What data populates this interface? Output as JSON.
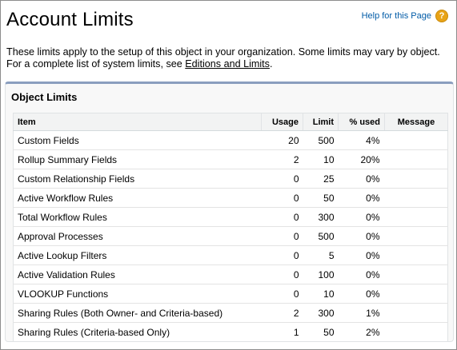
{
  "page": {
    "title": "Account Limits",
    "help_label": "Help for this Page",
    "intro_text": "These limits apply to the setup of this object in your organization. Some limits may vary by object. For a complete list of system limits, see ",
    "intro_link": "Editions and Limits",
    "intro_end": "."
  },
  "panel": {
    "title": "Object Limits"
  },
  "table": {
    "headers": {
      "item": "Item",
      "usage": "Usage",
      "limit": "Limit",
      "pct": "% used",
      "message": "Message"
    },
    "rows": [
      {
        "item": "Custom Fields",
        "usage": "20",
        "limit": "500",
        "pct": "4%",
        "message": ""
      },
      {
        "item": "Rollup Summary Fields",
        "usage": "2",
        "limit": "10",
        "pct": "20%",
        "message": ""
      },
      {
        "item": "Custom Relationship Fields",
        "usage": "0",
        "limit": "25",
        "pct": "0%",
        "message": ""
      },
      {
        "item": "Active Workflow Rules",
        "usage": "0",
        "limit": "50",
        "pct": "0%",
        "message": ""
      },
      {
        "item": "Total Workflow Rules",
        "usage": "0",
        "limit": "300",
        "pct": "0%",
        "message": ""
      },
      {
        "item": "Approval Processes",
        "usage": "0",
        "limit": "500",
        "pct": "0%",
        "message": ""
      },
      {
        "item": "Active Lookup Filters",
        "usage": "0",
        "limit": "5",
        "pct": "0%",
        "message": ""
      },
      {
        "item": "Active Validation Rules",
        "usage": "0",
        "limit": "100",
        "pct": "0%",
        "message": ""
      },
      {
        "item": "VLOOKUP Functions",
        "usage": "0",
        "limit": "10",
        "pct": "0%",
        "message": ""
      },
      {
        "item": "Sharing Rules (Both Owner- and Criteria-based)",
        "usage": "2",
        "limit": "300",
        "pct": "1%",
        "message": ""
      },
      {
        "item": "Sharing Rules (Criteria-based Only)",
        "usage": "1",
        "limit": "50",
        "pct": "2%",
        "message": ""
      }
    ]
  },
  "icons": {
    "help": "help-question-icon",
    "help_color": "#e8a317"
  }
}
